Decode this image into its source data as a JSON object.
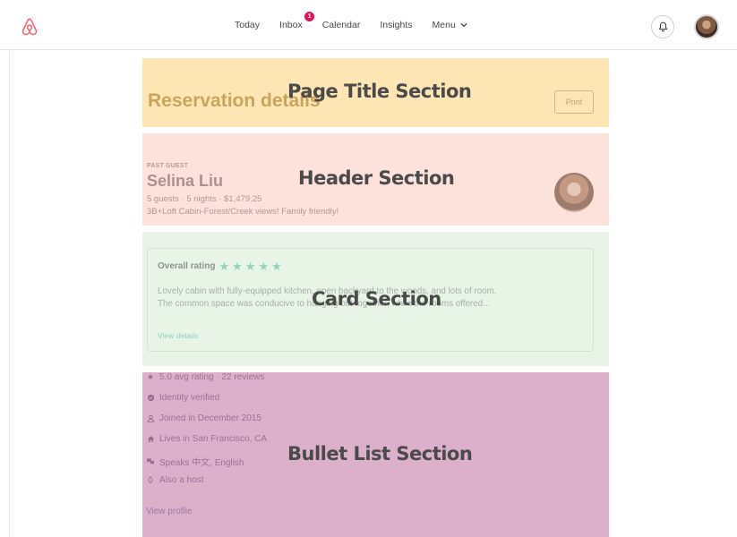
{
  "nav": {
    "items": [
      {
        "label": "Today"
      },
      {
        "label": "Inbox",
        "badge": "1"
      },
      {
        "label": "Calendar"
      },
      {
        "label": "Insights"
      },
      {
        "label": "Menu"
      }
    ],
    "brand_color": "#ff5a5f",
    "badge_color": "#e01561"
  },
  "sections": {
    "title": {
      "overlay_label": "Page Title Section",
      "page_title": "Reservation details",
      "print_label": "Print",
      "color": "#fde6b3"
    },
    "header": {
      "overlay_label": "Header Section",
      "eyebrow": "PAST GUEST",
      "guest_name": "Selina Liu",
      "meta": "5 guests · 5 nights · $1,479.25",
      "listing": "3B+Loft Cabin-Forest/Creek views! Family friendly!",
      "color": "#fde2dc"
    },
    "card": {
      "overlay_label": "Card Section",
      "rating_label": "Overall rating",
      "stars": 5,
      "review_line1": "Lovely cabin with fully-equipped kitchen, open backyard to the woods, and lots of room.",
      "review_line2": "The common space was conducive to hanging out together, while the rooms offered...",
      "view_details": "View details",
      "color": "#e8f5e6"
    },
    "list": {
      "overlay_label": "Bullet List Section",
      "items": [
        {
          "icon": "star-icon",
          "text": "5.0 avg rating · 22 reviews"
        },
        {
          "icon": "verified-shield-icon",
          "text": "Identity verified"
        },
        {
          "icon": "user-icon",
          "text": "Joined in December 2015"
        },
        {
          "icon": "home-icon",
          "text": "Lives in San Francisco, CA"
        },
        {
          "icon": "speech-bubbles-icon",
          "text": "Speaks 中文, English"
        },
        {
          "icon": "host-icon",
          "text": "Also a host"
        }
      ],
      "view_profile": "View profile",
      "color": "#dcafcb"
    }
  }
}
